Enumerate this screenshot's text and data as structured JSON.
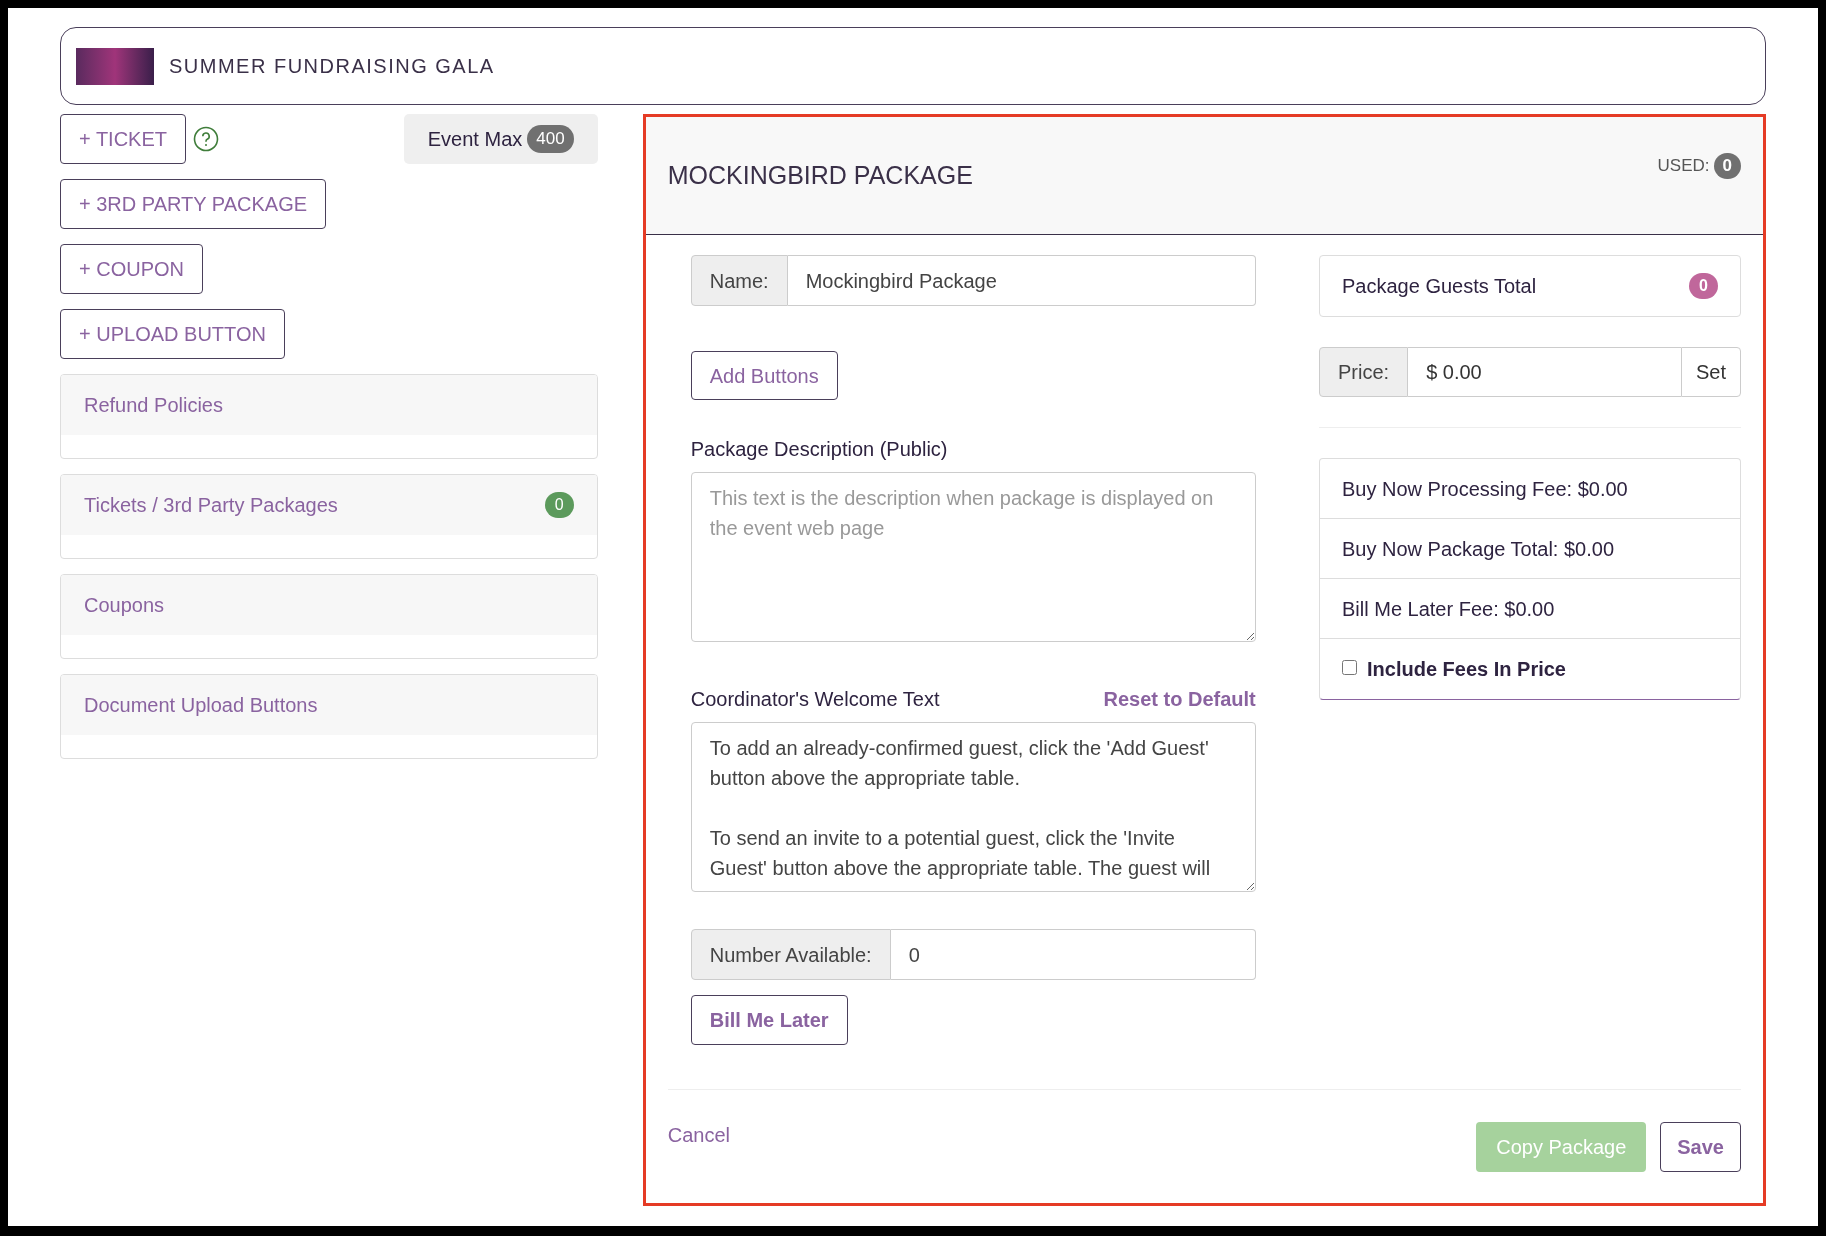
{
  "event": {
    "title": "SUMMER FUNDRAISING GALA"
  },
  "actions": [
    {
      "label": "+ TICKET",
      "help": true
    },
    {
      "label": "+ 3RD PARTY PACKAGE"
    },
    {
      "label": "+ COUPON"
    },
    {
      "label": "+ UPLOAD BUTTON"
    }
  ],
  "event_max": {
    "label": "Event Max",
    "count": "400"
  },
  "sections": [
    {
      "title": "Refund Policies"
    },
    {
      "title": "Tickets / 3rd Party Packages",
      "count": "0"
    },
    {
      "title": "Coupons"
    },
    {
      "title": "Document Upload Buttons"
    }
  ],
  "package": {
    "title": "MOCKINGBIRD PACKAGE",
    "used_label": "USED:",
    "used_count": "0",
    "name": {
      "label": "Name:",
      "value": "Mockingbird Package"
    },
    "add_buttons": "Add Buttons",
    "description": {
      "label": "Package Description (Public)",
      "placeholder": "This text is the description when package is displayed on the event web page"
    },
    "welcome": {
      "label": "Coordinator's Welcome Text",
      "reset": "Reset to Default",
      "value": "To add an already-confirmed guest, click the 'Add Guest' button above the appropriate table.\n\nTo send an invite to a potential guest, click the 'Invite Guest' button above the appropriate table. The guest will"
    },
    "number_available": {
      "label": "Number Available:",
      "value": "0"
    },
    "bill_me_later": "Bill Me Later",
    "guests_total": {
      "label": "Package Guests Total",
      "count": "0"
    },
    "price": {
      "label": "Price:",
      "value": "$ 0.00",
      "button": "Set"
    },
    "fees": [
      {
        "kind": "text",
        "label": "Buy Now Processing Fee: $0.00"
      },
      {
        "kind": "text",
        "label": "Buy Now Package Total: $0.00"
      },
      {
        "kind": "text",
        "label": "Bill Me Later Fee: $0.00"
      },
      {
        "kind": "checkbox",
        "label": "Include Fees In Price",
        "checked": false
      }
    ],
    "cancel": "Cancel",
    "copy": "Copy Package",
    "save": "Save"
  }
}
